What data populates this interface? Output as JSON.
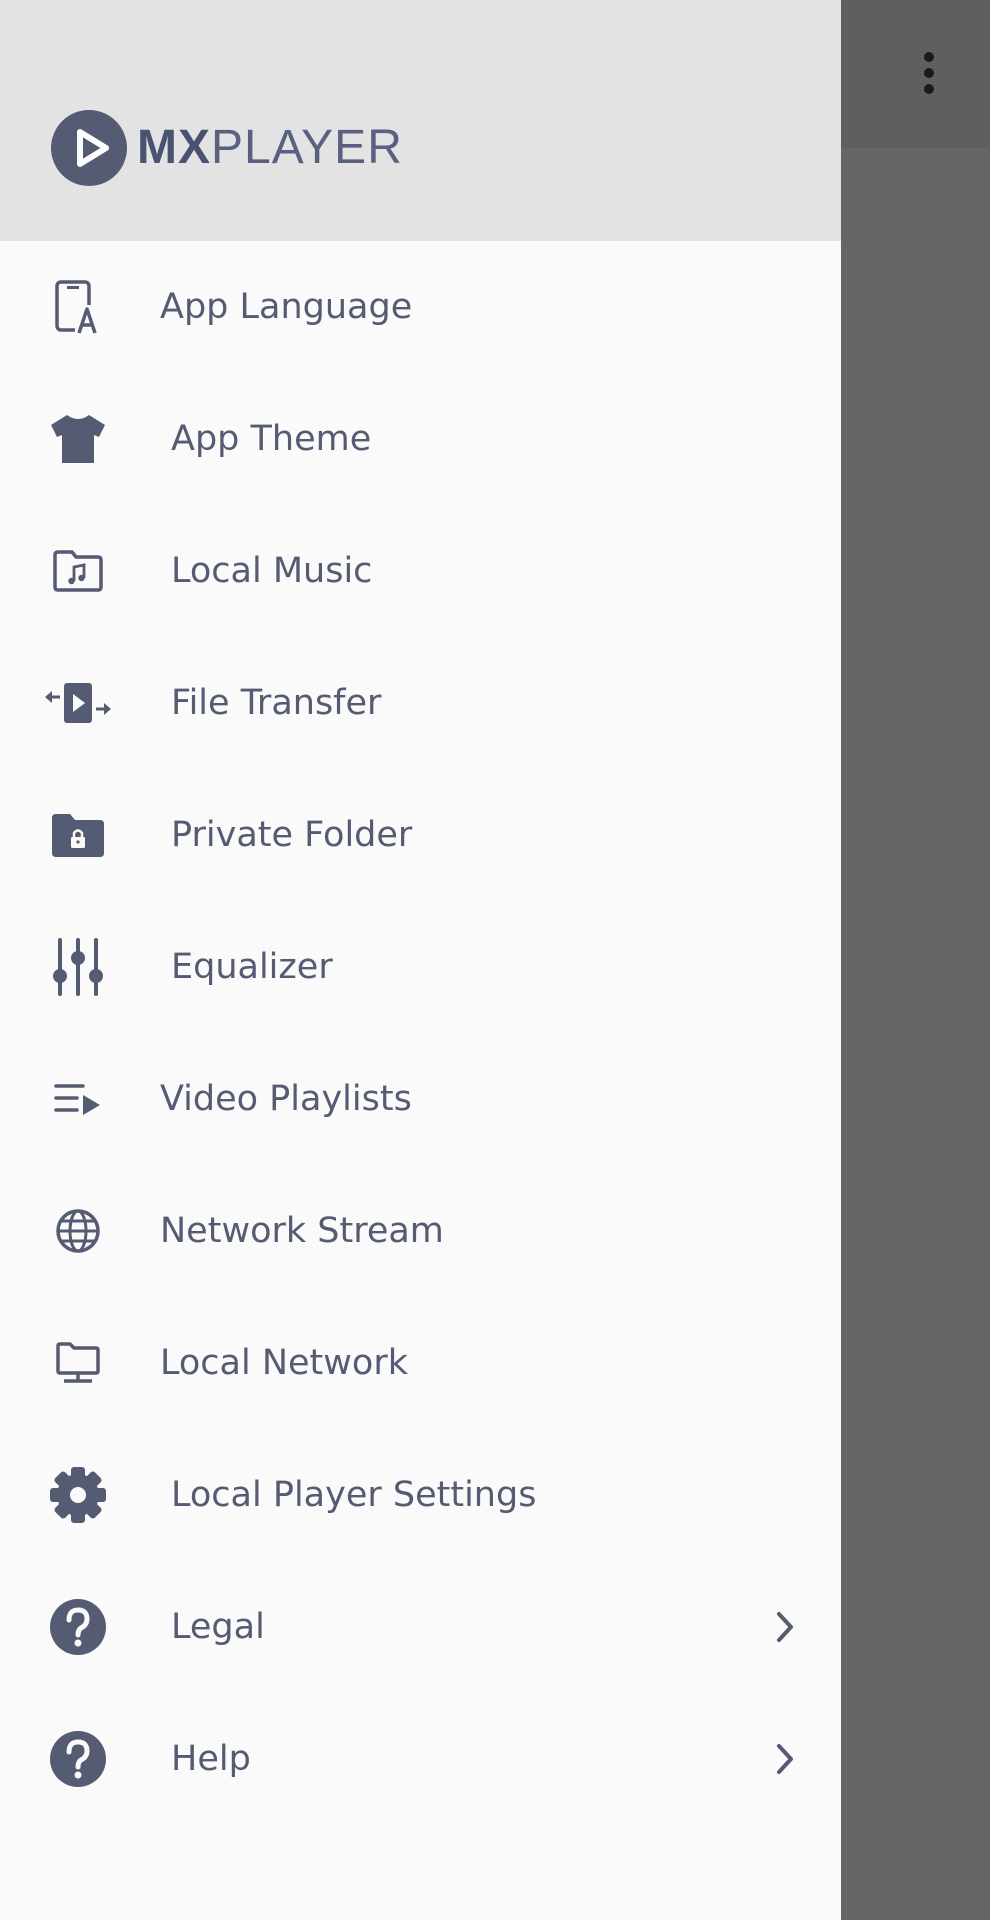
{
  "logo": {
    "text_bold": "MX",
    "text_light": "PLAYER"
  },
  "colors": {
    "icon": "#555b72",
    "label": "#555b72",
    "header_bg": "#e3e3e3",
    "drawer_bg": "#fafafa",
    "scrim": "#666666"
  },
  "menu": {
    "items": [
      {
        "label": "App Language",
        "icon": "app-language-icon"
      },
      {
        "label": "App Theme",
        "icon": "tshirt-icon"
      },
      {
        "label": "Local Music",
        "icon": "music-folder-icon"
      },
      {
        "label": "File Transfer",
        "icon": "file-transfer-icon"
      },
      {
        "label": "Private Folder",
        "icon": "lock-folder-icon"
      },
      {
        "label": "Equalizer",
        "icon": "equalizer-icon"
      },
      {
        "label": "Video Playlists",
        "icon": "playlist-icon"
      },
      {
        "label": "Network Stream",
        "icon": "globe-icon"
      },
      {
        "label": "Local Network",
        "icon": "monitor-icon"
      },
      {
        "label": "Local Player Settings",
        "icon": "gear-icon"
      },
      {
        "label": "Legal",
        "icon": "help-circle-icon",
        "has_chevron": true
      },
      {
        "label": "Help",
        "icon": "help-circle-icon",
        "has_chevron": true
      }
    ]
  }
}
